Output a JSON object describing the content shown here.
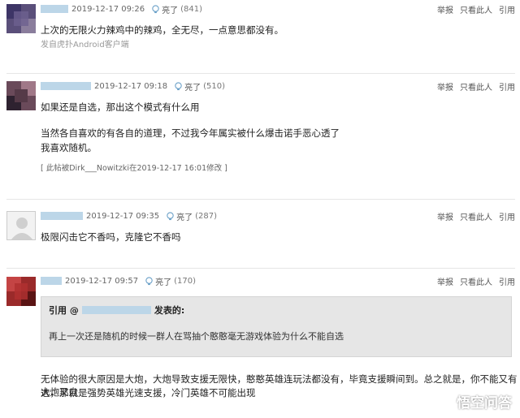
{
  "colors": {
    "link_blue": "#3366aa",
    "username_blur": "#bcd6e8",
    "quote_bg": "#e6e6e6"
  },
  "actions": [
    "举报",
    "只看此人",
    "引用"
  ],
  "light_label": "亮了",
  "posts": [
    {
      "time": "2019-12-17 09:26",
      "light_count": "(841)",
      "lines": [
        "上次的无限火力辣鸡中的辣鸡，全无尽，一点意思都没有。"
      ],
      "source": "发自虎扑Android客户端"
    },
    {
      "time": "2019-12-17 09:18",
      "light_count": "(510)",
      "lines": [
        "如果还是自选，那出这个模式有什么用",
        "当然各自喜欢的有各自的道理，不过我今年属实被什么爆击诺手恶心透了",
        "我喜欢随机。"
      ],
      "edit_note": "[ 此帖被Dirk___Nowitzki在2019-12-17 16:01修改 ]"
    },
    {
      "time": "2019-12-17 09:35",
      "light_count": "(287)",
      "lines": [
        "极限闪击它不香吗，克隆它不香吗"
      ]
    },
    {
      "time": "2019-12-17 09:57",
      "light_count": "(170)",
      "quote": {
        "prefix": "引用 @",
        "suffix": "发表的:",
        "text": "再上一次还是随机的时候一群人在骂抽个憨憨毫无游戏体验为什么不能自选"
      },
      "lines": [
        "无体验的很大原因是大炮，大炮导致支援无限快，憨憨英雄连玩法都没有，毕竟支援瞬间到。总之就是，你不能又有大炮又自",
        "选，那就是强势英雄光速支援，冷门英雄不可能出现"
      ]
    }
  ],
  "watermark": {
    "text": "悟空问答",
    "icon": "wukong-logo-icon"
  }
}
